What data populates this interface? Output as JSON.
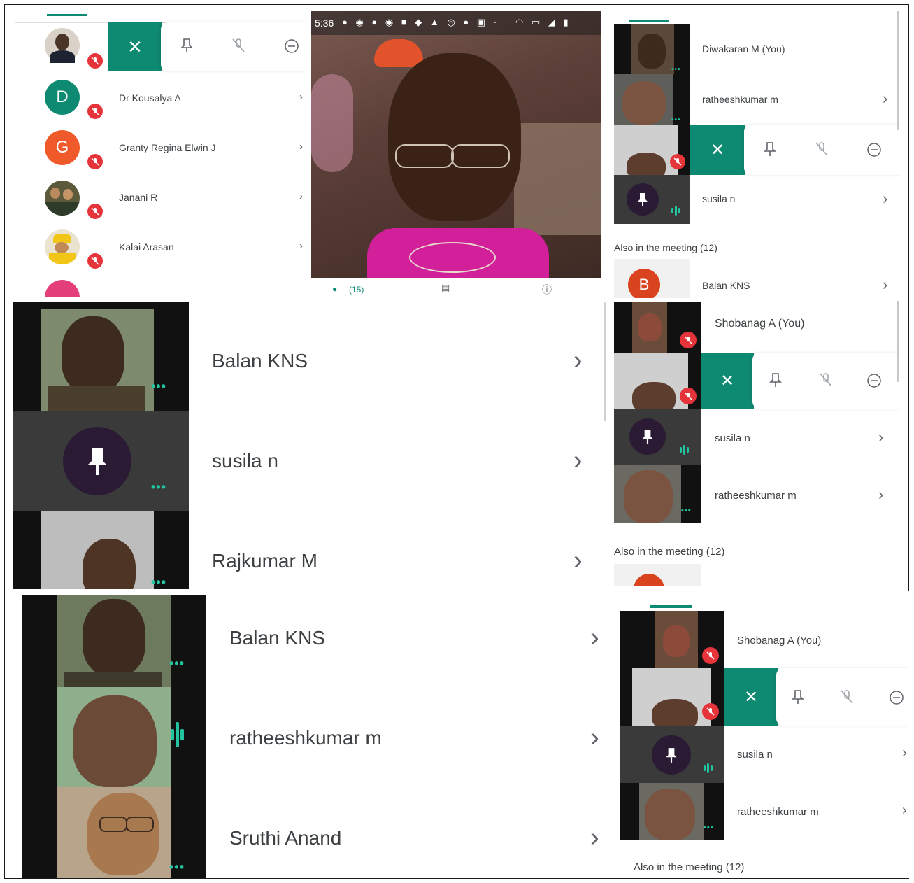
{
  "colors": {
    "accent": "#0f8a72",
    "mute": "#e5343a",
    "audio": "#21c5a0",
    "pin_bg": "#2a1a33"
  },
  "panel1": {
    "participants": [
      {
        "name": "Dr Kousalya A",
        "initial": "D",
        "color": "#0f8a72"
      },
      {
        "name": "Granty Regina Elwin J",
        "initial": "G",
        "color": "#f05a2a"
      },
      {
        "name": "Janani R"
      },
      {
        "name": "Kalai Arasan"
      }
    ]
  },
  "panel2": {
    "status_time": "5:36",
    "participant_count": "(15)"
  },
  "panel3": {
    "rows": [
      {
        "name": "Diwakaran M (You)"
      },
      {
        "name": "ratheeshkumar m"
      },
      {
        "name": "susila n"
      }
    ],
    "also_label": "Also in the meeting (12)",
    "also_row": {
      "name": "Balan KNS",
      "initial": "B",
      "color": "#d9431e"
    }
  },
  "panel4": {
    "rows": [
      {
        "name": "Balan KNS"
      },
      {
        "name": "susila n"
      },
      {
        "name": "Rajkumar M"
      }
    ]
  },
  "panel5": {
    "rows": [
      {
        "name": "Shobanag A (You)"
      },
      {
        "name": "susila n"
      },
      {
        "name": "ratheeshkumar m"
      }
    ],
    "also_label": "Also in the meeting (12)"
  },
  "panel6": {
    "rows": [
      {
        "name": "Balan KNS"
      },
      {
        "name": "ratheeshkumar m"
      },
      {
        "name": "Sruthi Anand"
      }
    ]
  },
  "panel7": {
    "rows": [
      {
        "name": "Shobanag A (You)"
      },
      {
        "name": "susila n"
      },
      {
        "name": "ratheeshkumar m"
      }
    ],
    "also_label": "Also in the meeting (12)"
  }
}
